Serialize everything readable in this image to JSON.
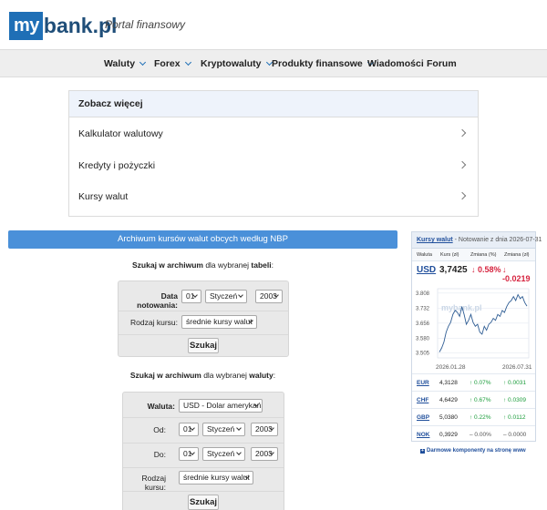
{
  "header": {
    "logo_my": "my",
    "logo_bank": "bank.pl",
    "tagline": "Portal finansowy"
  },
  "nav": {
    "items": [
      {
        "label": "Waluty",
        "dropdown": true
      },
      {
        "label": "Forex",
        "dropdown": true
      },
      {
        "label": "Kryptowaluty",
        "dropdown": true
      },
      {
        "label": "Produkty finansowe",
        "dropdown": true
      },
      {
        "label": "Wiadomości",
        "dropdown": false
      },
      {
        "label": "Forum",
        "dropdown": false
      }
    ]
  },
  "more": {
    "title": "Zobacz więcej",
    "links": [
      "Kalkulator walutowy",
      "Kredyty i pożyczki",
      "Kursy walut"
    ]
  },
  "archive": {
    "title": "Archiwum kursów walut obcych według NBP",
    "table_search": {
      "prefix": "Szukaj w archiwum",
      "middle": " dla wybranej ",
      "suffix": "tabeli",
      "end": ":",
      "date_label": "Data notowania:",
      "day": "01",
      "month": "Styczeń",
      "year": "2003",
      "type_label": "Rodzaj kursu:",
      "type_value": "średnie kursy walut",
      "button": "Szukaj"
    },
    "currency_search": {
      "prefix": "Szukaj w archiwum",
      "middle": " dla wybranej ",
      "suffix": "waluty",
      "end": ":",
      "currency_label": "Waluta:",
      "currency_value": "USD - Dolar amerykański",
      "from_label": "Od:",
      "from_day": "01",
      "from_month": "Styczeń",
      "from_year": "2003",
      "to_label": "Do:",
      "to_day": "01",
      "to_month": "Styczeń",
      "to_year": "2003",
      "type_label": "Rodzaj kursu:",
      "type_value": "średnie kursy walut",
      "button": "Szukaj"
    }
  },
  "widget": {
    "title_link": "Kursy walut",
    "title_rest": " - Notowanie z dnia 2026-07-31",
    "columns": [
      "Waluta",
      "Kurs (zł)",
      "Zmiana (%)",
      "Zmiana (zł)"
    ],
    "main": {
      "code": "USD",
      "rate": "3,7425",
      "pct": "↓ 0.58%",
      "abs": "↓ -0.0219",
      "trend": "down"
    },
    "rows": [
      {
        "code": "EUR",
        "rate": "4,3128",
        "pct": "↑ 0.07%",
        "abs": "↑ 0.0031",
        "trend": "up"
      },
      {
        "code": "CHF",
        "rate": "4,6429",
        "pct": "↑ 0.67%",
        "abs": "↑ 0.0309",
        "trend": "up"
      },
      {
        "code": "GBP",
        "rate": "5,0380",
        "pct": "↑ 0.22%",
        "abs": "↑ 0.0112",
        "trend": "up"
      },
      {
        "code": "NOK",
        "rate": "0,3929",
        "pct": "– 0.00%",
        "abs": "– 0.0000",
        "trend": "flat"
      }
    ],
    "footer": "Darmowe komponenty na stronę www",
    "watermark": "mybank.pl"
  },
  "chart_data": {
    "type": "line",
    "x_start_label": "2026.01.28",
    "x_end_label": "2026.07.31",
    "y_ticks": [
      "3.808",
      "3.732",
      "3.656",
      "3.580",
      "3.505"
    ],
    "ylim": [
      3.48,
      3.83
    ],
    "series": [
      {
        "values": [
          3.51,
          3.53,
          3.56,
          3.61,
          3.64,
          3.66,
          3.7,
          3.72,
          3.71,
          3.69,
          3.74,
          3.7,
          3.65,
          3.67,
          3.7,
          3.66,
          3.64,
          3.65,
          3.61,
          3.6,
          3.64,
          3.62,
          3.65,
          3.66,
          3.68,
          3.67,
          3.7,
          3.69,
          3.72,
          3.71,
          3.74,
          3.76,
          3.77,
          3.79,
          3.77,
          3.8,
          3.78,
          3.79,
          3.76,
          3.742
        ]
      }
    ],
    "line_color": "#2f5d94",
    "grid": true
  }
}
